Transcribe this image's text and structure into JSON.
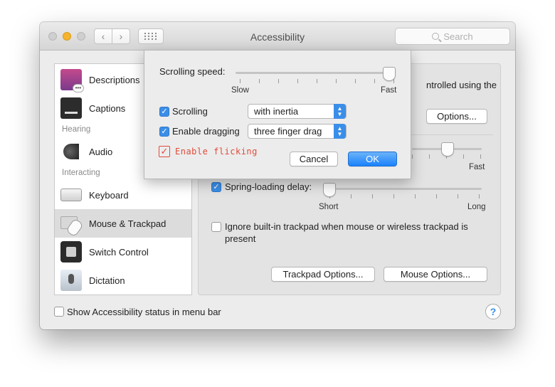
{
  "window": {
    "title": "Accessibility",
    "search_placeholder": "Search"
  },
  "sidebar": {
    "items": [
      {
        "label": "Descriptions"
      },
      {
        "label": "Captions"
      },
      {
        "label": "Audio"
      },
      {
        "label": "Keyboard"
      },
      {
        "label": "Mouse & Trackpad",
        "selected": true
      },
      {
        "label": "Switch Control"
      },
      {
        "label": "Dictation"
      }
    ],
    "sections": {
      "hearing": "Hearing",
      "interacting": "Interacting"
    }
  },
  "pane": {
    "partial_text": "ntrolled using the",
    "options_button": "Options...",
    "fast_label": "Fast",
    "spring_loading": {
      "label": "Spring-loading delay:",
      "checked": true,
      "min_label": "Short",
      "max_label": "Long"
    },
    "ignore_trackpad": {
      "label": "Ignore built-in trackpad when mouse or wireless trackpad is",
      "label_cont": "present",
      "checked": false
    },
    "trackpad_options_button": "Trackpad Options...",
    "mouse_options_button": "Mouse Options..."
  },
  "bottom": {
    "show_status_label": "Show Accessibility status in menu bar",
    "show_status_checked": false,
    "help_symbol": "?"
  },
  "sheet": {
    "scrolling_speed_label": "Scrolling speed:",
    "slow_label": "Slow",
    "fast_label": "Fast",
    "scrolling_speed_level": 1.0,
    "scrolling": {
      "label": "Scrolling",
      "checked": true,
      "selected_option": "with inertia"
    },
    "dragging": {
      "label": "Enable dragging",
      "checked": true,
      "selected_option": "three finger drag"
    },
    "flicking": {
      "label": "Enable flicking",
      "checked": true
    },
    "cancel_button": "Cancel",
    "ok_button": "OK"
  },
  "colors": {
    "accent": "#3b8ee8",
    "annotation": "#e04b3a",
    "traffic_minimize": "#f5b42c"
  },
  "icons": {
    "nav_back": "‹",
    "nav_forward": "›",
    "check": "✓",
    "popup_up": "▲",
    "popup_down": "▼"
  }
}
